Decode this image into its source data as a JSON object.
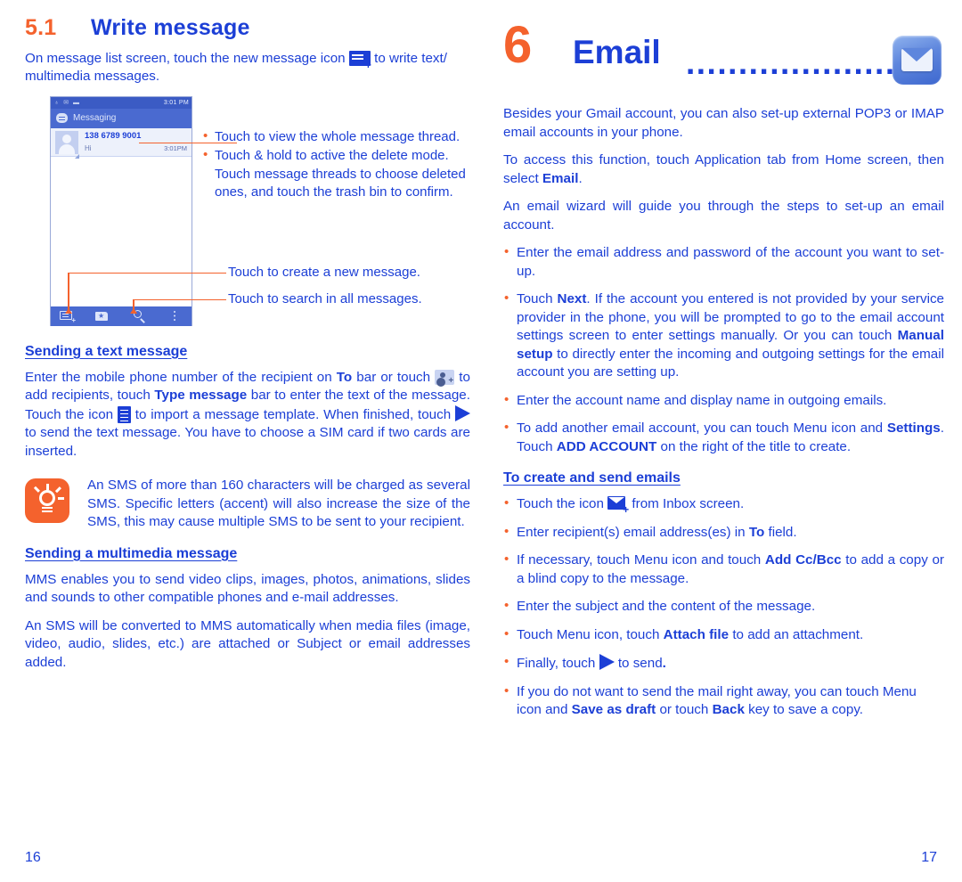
{
  "left_page": {
    "section_number": "5.1",
    "section_title": "Write message",
    "intro_before_icon": "On message list screen, touch the new message icon",
    "intro_after_icon": "to write text/ multimedia messages.",
    "phone_mock": {
      "status_left_icons": "♁ ✉ ▬",
      "status_right": "3:01 PM",
      "app_title": "Messaging",
      "thread_number": "138 6789 9001",
      "thread_snippet": "Hi",
      "thread_time": "3:01PM",
      "toolbar_icons": [
        "new-message-icon",
        "folder-star-icon",
        "search-icon",
        "overflow-menu-icon"
      ]
    },
    "callouts": {
      "bullet_1": "Touch to view the whole message thread.",
      "bullet_2": "Touch & hold to active the delete mode. Touch message threads to choose deleted ones, and touch the trash bin to confirm.",
      "line_new_message": "Touch to create a new message.",
      "line_search": "Touch to search in all messages."
    },
    "sub_text_heading": "Sending a text message",
    "text_para": {
      "p1": "Enter the mobile phone number of the recipient on",
      "b1": "To",
      "p2": "bar or touch",
      "p3": "to add recipients, touch",
      "b2": "Type message",
      "p4": "bar to enter the text of the message. Touch the icon",
      "p5": "to import a message template. When finished, touch",
      "p6": "to send the text message. You have to choose a SIM card if two cards are inserted."
    },
    "tip": "An SMS of more than 160 characters will be charged as several SMS. Specific letters (accent) will also increase the size of the SMS, this may cause multiple SMS to be sent to your recipient.",
    "sub_mms_heading": "Sending a multimedia message",
    "mms_para_1": "MMS enables you to send video clips, images, photos, animations, slides and sounds to other compatible phones and e-mail addresses.",
    "mms_para_2": "An SMS will be converted to MMS automatically when media files (image, video, audio, slides, etc.) are attached or Subject or email addresses added.",
    "page_number": "16"
  },
  "right_page": {
    "chapter_number": "6",
    "chapter_title": "Email",
    "dots": "........................",
    "intro": "Besides your Gmail account, you can also set-up external POP3 or IMAP email accounts in your phone.",
    "access_p1": "To access this function, touch Application tab from Home screen, then select",
    "access_b": "Email",
    "access_p2": ".",
    "wizard": "An email wizard will guide you through the steps to set-up an email account.",
    "bullets": {
      "b1": "Enter the email address and password of the account you want to set-up.",
      "b2_p1": "Touch",
      "b2_b1": "Next",
      "b2_p2": ". If the account you entered is not provided by your service provider in the phone, you will be prompted to go to the email account settings screen to enter settings manually. Or you can touch",
      "b2_b2": "Manual setup",
      "b2_p3": "to directly enter the incoming and outgoing settings for the email account you are setting up.",
      "b3": "Enter the account name and display name in outgoing emails.",
      "b4_p1": "To add another email account, you can touch Menu icon and",
      "b4_b1": "Settings",
      "b4_p2": ". Touch",
      "b4_b2": "ADD ACCOUNT",
      "b4_p3": "on the right of the title to create."
    },
    "create_heading": "To create and send emails",
    "create_bullets": {
      "c1_p1": "Touch the icon",
      "c1_p2": "from Inbox screen.",
      "c2_p1": "Enter recipient(s) email address(es) in",
      "c2_b1": "To",
      "c2_p2": "field.",
      "c3_p1": "If necessary, touch Menu icon and touch",
      "c3_b1": "Add Cc/Bcc",
      "c3_p2": "to add a copy or a blind copy to the message.",
      "c4": "Enter the subject and the content of the message.",
      "c5_p1": "Touch Menu icon, touch",
      "c5_b1": "Attach file",
      "c5_p2": "to add an attachment.",
      "c6_p1": "Finally, touch",
      "c6_p2": "to send",
      "c6_p3": ".",
      "c7_p1": "If you do not want to send the mail right away, you can touch Menu icon and",
      "c7_b1": "Save as draft",
      "c7_p2": "or touch",
      "c7_b2": "Back",
      "c7_p3": "key to save a copy."
    },
    "page_number": "17"
  },
  "colors": {
    "accent_orange": "#F4622D",
    "text_blue": "#1C3FD6",
    "phone_header_blue": "#4A6AD0"
  }
}
